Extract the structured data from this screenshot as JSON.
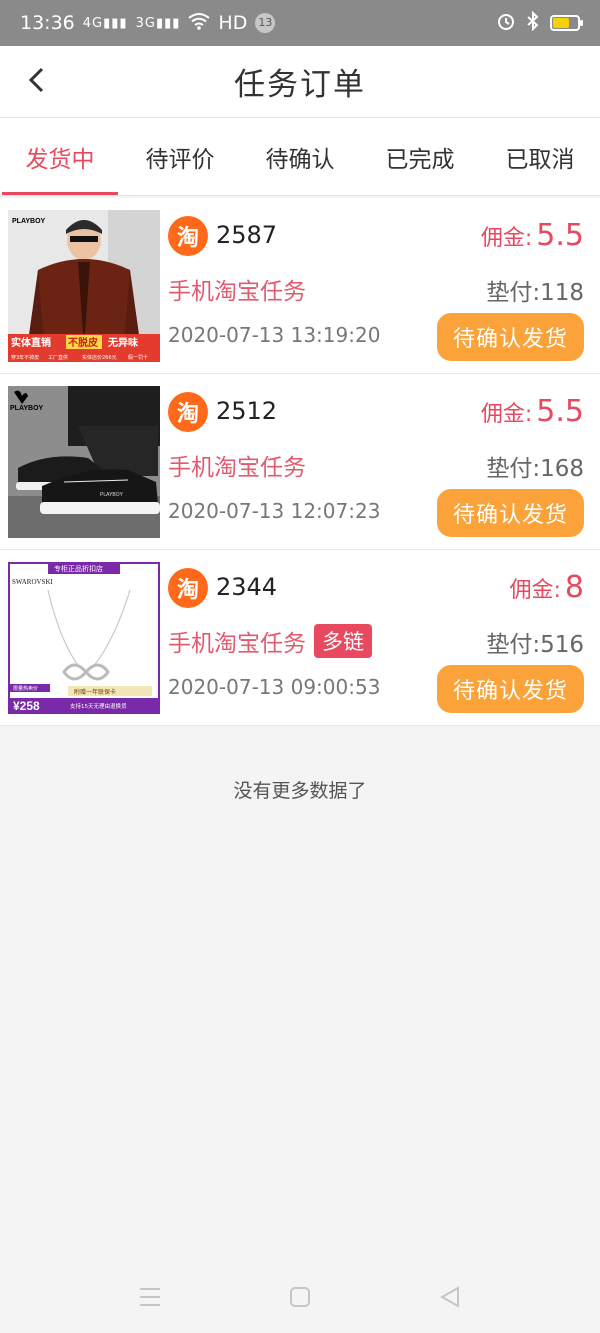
{
  "status_bar": {
    "time": "13:36",
    "signal_1": "4G",
    "signal_2": "3G",
    "hd": "HD",
    "notification_count": "13",
    "icons": [
      "alarm-icon",
      "bluetooth-icon",
      "battery-icon"
    ],
    "battery_level": 0.65
  },
  "nav": {
    "back_icon": "chevron-left-icon",
    "title": "任务订单"
  },
  "tabs": [
    {
      "label": "发货中",
      "active": true
    },
    {
      "label": "待评价",
      "active": false
    },
    {
      "label": "待确认",
      "active": false
    },
    {
      "label": "已完成",
      "active": false
    },
    {
      "label": "已取消",
      "active": false
    }
  ],
  "orders": [
    {
      "image": "leather-jacket-product-image",
      "image_texts": [
        "PLAYBOY",
        "实体直销",
        "不脱皮",
        "无异味",
        "穿3年不掉皮",
        "工厂直供",
        "实体店价266元",
        "假一罚十"
      ],
      "shop_icon": "taobao-icon",
      "shop_icon_glyph": "淘",
      "id": "2587",
      "commission_label": "佣金:",
      "commission": "5.5",
      "task_type": "手机淘宝任务",
      "multi_tag": "",
      "advance": "垫付:118",
      "time": "2020-07-13 13:19:20",
      "action": "待确认发货"
    },
    {
      "image": "sneaker-product-image",
      "image_texts": [
        "PLAYBOY"
      ],
      "shop_icon": "taobao-icon",
      "shop_icon_glyph": "淘",
      "id": "2512",
      "commission_label": "佣金:",
      "commission": "5.5",
      "task_type": "手机淘宝任务",
      "multi_tag": "",
      "advance": "垫付:168",
      "time": "2020-07-13 12:07:23",
      "action": "待确认发货"
    },
    {
      "image": "necklace-product-image",
      "image_texts": [
        "专柜正品折扣店",
        "SWAROVSKI",
        "附赠一年联保卡",
        "限量热卖价",
        "¥258",
        "支持15天无理由退换货"
      ],
      "shop_icon": "taobao-icon",
      "shop_icon_glyph": "淘",
      "id": "2344",
      "commission_label": "佣金:",
      "commission": "8",
      "task_type": "手机淘宝任务",
      "multi_tag": "多链",
      "advance": "垫付:516",
      "time": "2020-07-13 09:00:53",
      "action": "待确认发货"
    }
  ],
  "footer_text": "没有更多数据了",
  "system_nav": [
    "menu-icon",
    "home-icon",
    "back-icon"
  ],
  "colors": {
    "accent": "#e8495e",
    "button": "#fba33a",
    "shop_icon": "#ff6a1a",
    "battery": "#f5d10b"
  }
}
